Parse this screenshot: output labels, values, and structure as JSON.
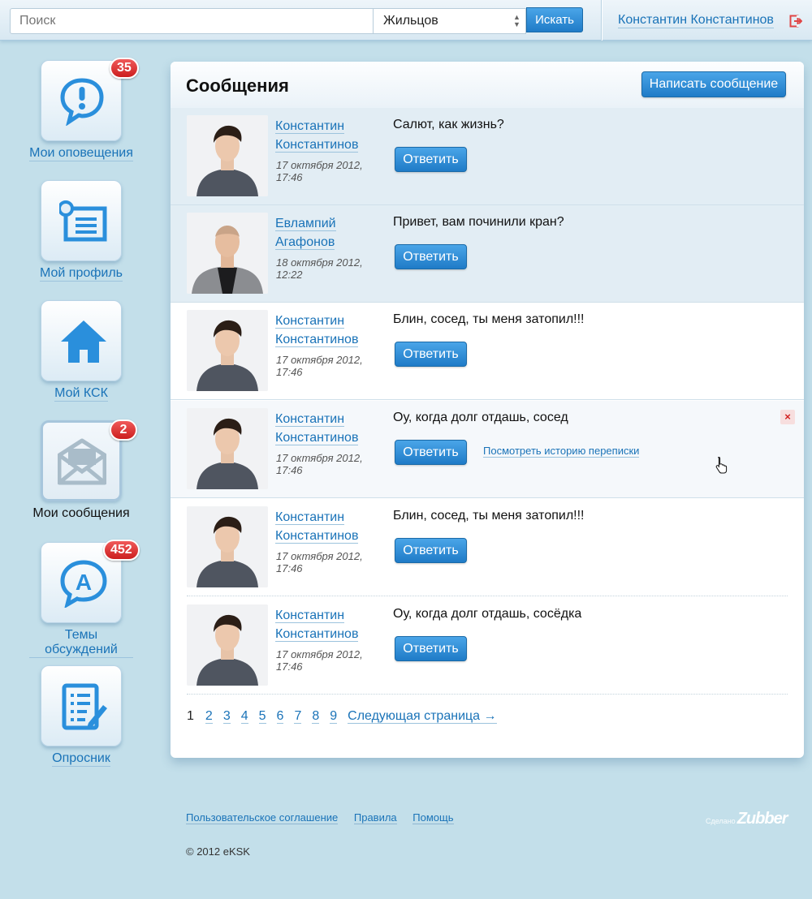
{
  "search": {
    "placeholder": "Поиск",
    "scope_selected": "Жильцов",
    "button_label": "Искать"
  },
  "user": {
    "name": "Константин Константинов",
    "logout_icon": "logout-icon"
  },
  "sidebar": {
    "items": [
      {
        "label": "Мои оповещения",
        "icon": "alert-bubble-icon",
        "badge": "35"
      },
      {
        "label": "Мой профиль",
        "icon": "profile-card-icon",
        "badge": ""
      },
      {
        "label": "Мой КСК",
        "icon": "home-icon",
        "badge": ""
      },
      {
        "label": "Мои сообщения",
        "icon": "envelope-icon",
        "badge": "2",
        "active": true
      },
      {
        "label": "Темы обсуждений",
        "icon": "discussion-icon",
        "badge": "452"
      },
      {
        "label": "Опросник",
        "icon": "survey-icon",
        "badge": ""
      }
    ]
  },
  "main": {
    "title": "Сообщения",
    "write_button": "Написать сообщение",
    "reply_label": "Ответить",
    "history_link": "Посмотреть историю переписки",
    "delete_symbol": "×",
    "messages": [
      {
        "first": "Константин",
        "last": "Константинов",
        "date": "17 октября 2012,",
        "time": "17:46",
        "text": "Салют, как жизнь?",
        "state": "unread",
        "avatar": "man-sweater"
      },
      {
        "first": "Евлампий",
        "last": "Агафонов",
        "date": "18 октября 2012,",
        "time": "12:22",
        "text": "Привет, вам починили кран?",
        "state": "unread",
        "avatar": "man-jacket"
      },
      {
        "first": "Константин",
        "last": "Константинов",
        "date": "17 октября 2012,",
        "time": "17:46",
        "text": "Блин, сосед, ты меня затопил!!!",
        "state": "read",
        "avatar": "man-sweater"
      },
      {
        "first": "Константин",
        "last": "Константинов",
        "date": "17 октября 2012,",
        "time": "17:46",
        "text": "Оу, когда долг отдашь, сосед",
        "state": "hover",
        "avatar": "man-sweater"
      },
      {
        "first": "Константин",
        "last": "Константинов",
        "date": "17 октября 2012,",
        "time": "17:46",
        "text": "Блин, сосед, ты меня затопил!!!",
        "state": "read",
        "avatar": "man-sweater"
      },
      {
        "first": "Константин",
        "last": "Константинов",
        "date": "17 октября 2012,",
        "time": "17:46",
        "text": "Оу, когда долг отдашь, сосёдка",
        "state": "read",
        "avatar": "man-sweater"
      }
    ],
    "pagination": {
      "current": "1",
      "pages": [
        "2",
        "3",
        "4",
        "5",
        "6",
        "7",
        "8",
        "9"
      ],
      "next": "Следующая страница →"
    }
  },
  "footer": {
    "links": [
      "Пользовательское соглашение",
      "Правила",
      "Помощь"
    ],
    "copyright": "© 2012 eKSK",
    "made_by_prefix": "Сделано",
    "made_by_logo": "Zubber"
  },
  "colors": {
    "background": "#c3dfea",
    "accent": "#1f7bc7",
    "link": "#1a73b8",
    "badge": "#d62828",
    "unread_row": "#e2edf4"
  }
}
